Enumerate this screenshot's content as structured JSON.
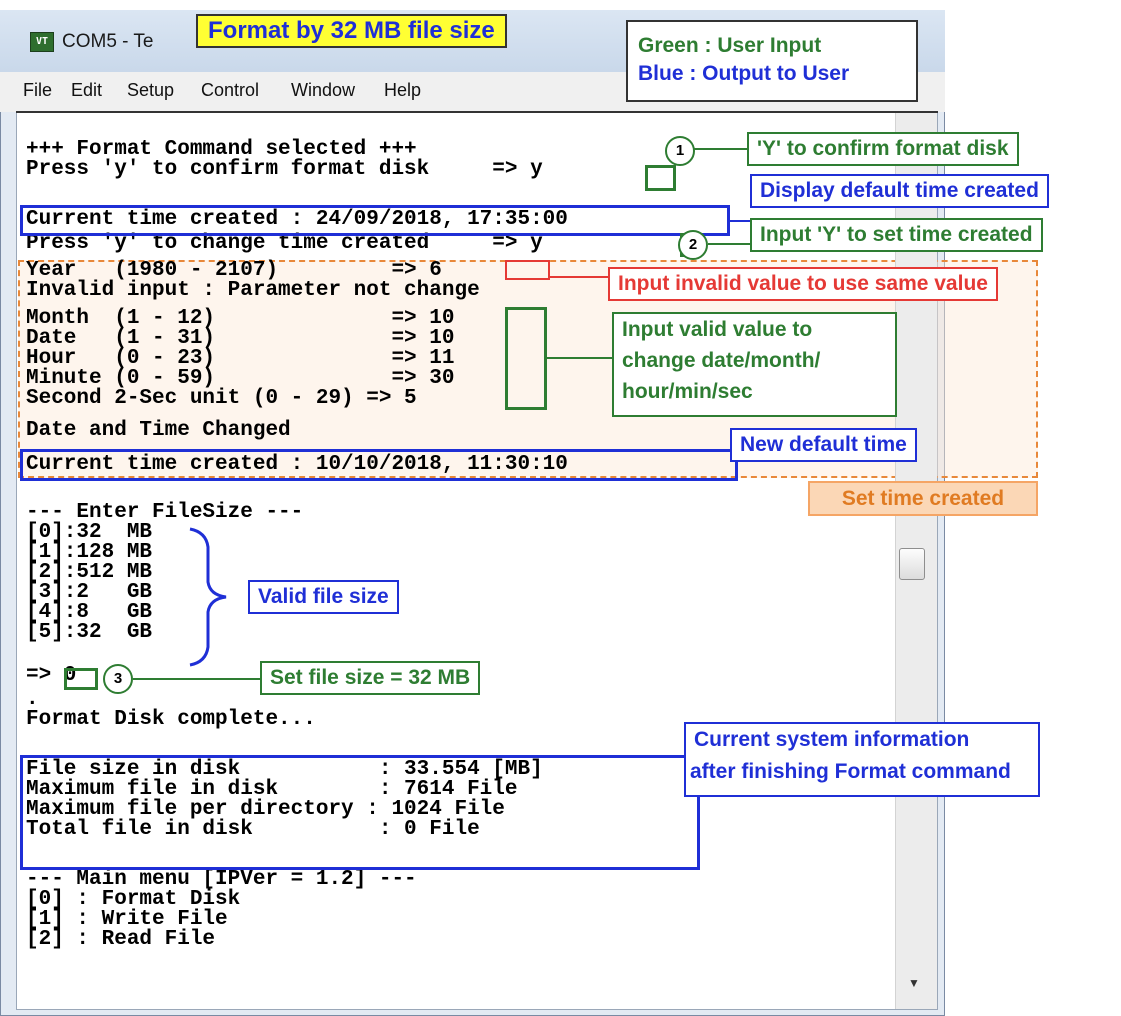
{
  "window": {
    "title": "COM5 - Te",
    "icon": "terminal-app-icon"
  },
  "menu": [
    "File",
    "Edit",
    "Setup",
    "Control",
    "Window",
    "Help"
  ],
  "terminal": {
    "lines": [
      "+++ Format Command selected +++",
      "Press 'y' to confirm format disk     => y",
      "",
      "Current time created : 24/09/2018, 17:35:00",
      "Press 'y' to change time created     => y",
      "Year   (1980 - 2107)         => 6",
      "Invalid input : Parameter not change",
      "Month  (1 - 12)              => 10",
      "Date   (1 - 31)              => 10",
      "Hour   (0 - 23)              => 11",
      "Minute (0 - 59)              => 30",
      "Second 2-Sec unit (0 - 29) => 5",
      "Date and Time Changed",
      "Current time created : 10/10/2018, 11:30:10",
      "",
      "--- Enter FileSize ---",
      "[0]:32  MB",
      "[1]:128 MB",
      "[2]:512 MB",
      "[3]:2   GB",
      "[4]:8   GB",
      "[5]:32  GB",
      "=> 0",
      ".",
      "Format Disk complete...",
      "",
      "File size in disk           : 33.554 [MB]",
      "Maximum file in disk        : 7614 File",
      "Maximum file per directory : 1024 File",
      "Total file in disk          : 0 File",
      "",
      "--- Main menu [IPVer = 1.2] ---",
      "[0] : Format Disk",
      "[1] : Write File",
      "[2] : Read File"
    ]
  },
  "annotations": {
    "title": "Format by 32 MB file size",
    "legend_green": "Green : User Input",
    "legend_blue": "Blue : Output to User",
    "confirm": "'Y' to confirm format disk",
    "display_default": "Display default time created",
    "input_y": "Input 'Y' to set time created",
    "invalid": "Input invalid value to use same value",
    "valid_line1": "Input valid value to",
    "valid_line2": "change date/month/",
    "valid_line3": "hour/min/sec",
    "new_default": "New default time",
    "set_time": "Set time created",
    "valid_size": "Valid file size",
    "set_size": "Set file size = 32 MB",
    "sysinfo_line1": "Current system information",
    "sysinfo_line2": "after finishing Format command",
    "step1": "1",
    "step2": "2",
    "step3": "3"
  },
  "colors": {
    "user_input": "#2e7d32",
    "output": "#1f2fd6",
    "invalid": "#e53935",
    "time_group": "#e8883a"
  }
}
